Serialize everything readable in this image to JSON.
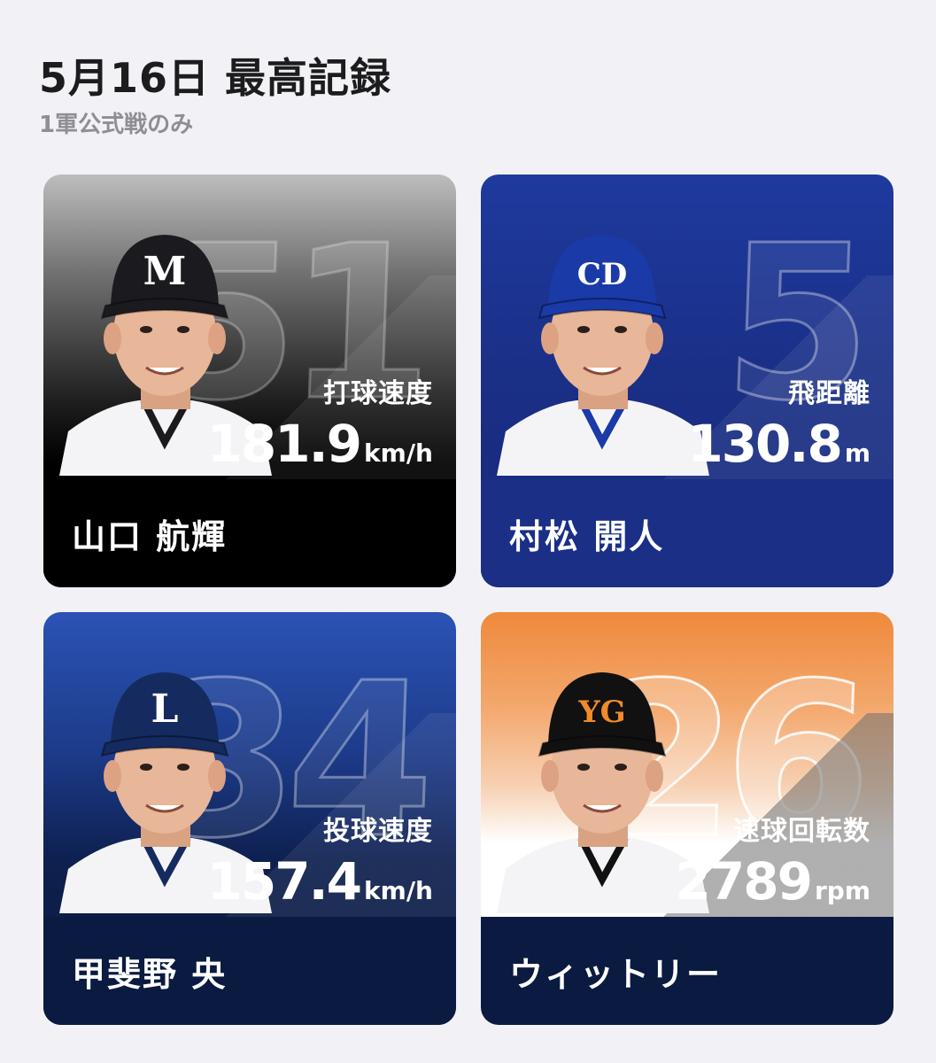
{
  "header": {
    "title": "5月16日 最高記録",
    "subtitle": "1軍公式戦のみ"
  },
  "cards": [
    {
      "number": "51",
      "stat_label": "打球速度",
      "stat_value": "181.9",
      "stat_unit": "km/h",
      "player_name": "山口 航輝",
      "cap_letter": "M",
      "cap_color": "#1b1b1f",
      "photo_bg": "#bdbdbd"
    },
    {
      "number": "5",
      "stat_label": "飛距離",
      "stat_value": "130.8",
      "stat_unit": "m",
      "player_name": "村松 開人",
      "cap_letter": "CD",
      "cap_color": "#1a3aa8",
      "photo_bg": "#16297c"
    },
    {
      "number": "34",
      "stat_label": "投球速度",
      "stat_value": "157.4",
      "stat_unit": "km/h",
      "player_name": "甲斐野 央",
      "cap_letter": "L",
      "cap_color": "#152a5e",
      "photo_bg": "#1b3b8c"
    },
    {
      "number": "26",
      "stat_label": "速球回転数",
      "stat_value": "2789",
      "stat_unit": "rpm",
      "player_name": "ウィットリー",
      "cap_letter": "YG",
      "cap_color": "#111111",
      "photo_bg": "#f29a52"
    }
  ]
}
